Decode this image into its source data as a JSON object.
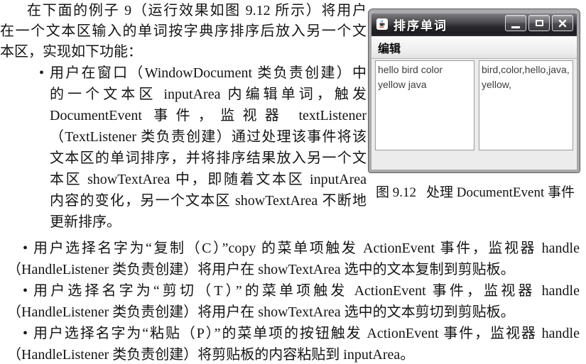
{
  "document": {
    "bullet_glyph": "•",
    "intro": [
      "在下面的例子 9（运行效果如图 9.12 所示）将用户",
      "在一个文本区输入的单词按字典序排序后放入另一个文",
      "本区，实现如下功能："
    ],
    "bullets": [
      {
        "lines": [
          "用户在窗口（WindowDocument 类负责创建）中",
          "的一个文本区 inputArea 内编辑单词，触发",
          "DocumentEvent 事件，监视器 textListener",
          "（TextListener 类负责创建）通过处理该事件将该",
          "文本区的单词排序，并将排序结果放入另一个文",
          "本区 showTextArea 中，即随着文本区 inputArea",
          "内容的变化，另一个文本区 showTextArea 不断地",
          "更新排序。"
        ]
      },
      {
        "lines": [
          "用户选择名字为“复制（C）”copy 的菜单项触发 ActionEvent 事件，监视器 handle",
          "（HandleListener 类负责创建）将用户在 showTextArea 选中的文本复制到剪贴板。"
        ]
      },
      {
        "lines": [
          "用户选择名字为“剪切（T）”的菜单项触发 ActionEvent 事件，监视器 handle",
          "（HandleListener 类负责创建）将用户在 showTextArea 选中的文本剪切到剪贴板。"
        ]
      },
      {
        "lines": [
          "用户选择名字为“粘贴（P）”的菜单项的按钮触发 ActionEvent 事件，监视器 handle",
          "（HandleListener 类负责创建）将剪贴板的内容粘贴到 inputArea。"
        ]
      }
    ]
  },
  "figure": {
    "window": {
      "title": "排序单词",
      "menu_items": [
        "编辑"
      ],
      "input_area_text": "hello bird color\nyellow java",
      "show_area_text": "bird,color,hello,java,\nyellow,"
    },
    "caption": {
      "label": "图 9.12",
      "text": "处理 DocumentEvent 事件"
    }
  }
}
